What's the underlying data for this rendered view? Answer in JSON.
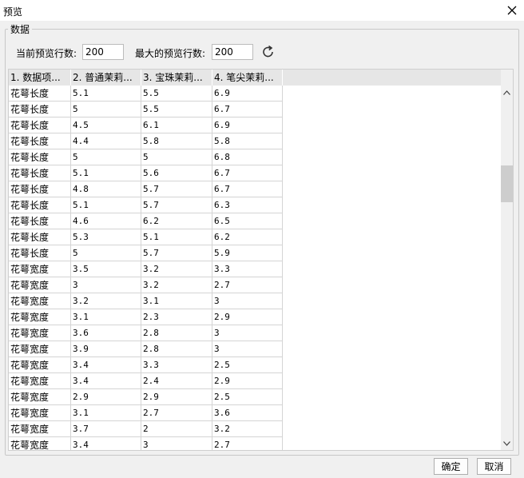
{
  "window": {
    "title": "预览"
  },
  "group": {
    "label": "数据"
  },
  "controls": {
    "current_rows_label": "当前预览行数:",
    "current_rows_value": "200",
    "max_rows_label": "最大的预览行数:",
    "max_rows_value": "200"
  },
  "table": {
    "columns": [
      "1. 数据项...",
      "2. 普通茉莉...",
      "3. 宝珠茉莉...",
      "4. 笔尖茉莉..."
    ],
    "rows": [
      [
        "花萼长度",
        "5.1",
        "5.5",
        "6.9"
      ],
      [
        "花萼长度",
        "5",
        "5.5",
        "6.7"
      ],
      [
        "花萼长度",
        "4.5",
        "6.1",
        "6.9"
      ],
      [
        "花萼长度",
        "4.4",
        "5.8",
        "5.8"
      ],
      [
        "花萼长度",
        "5",
        "5",
        "6.8"
      ],
      [
        "花萼长度",
        "5.1",
        "5.6",
        "6.7"
      ],
      [
        "花萼长度",
        "4.8",
        "5.7",
        "6.7"
      ],
      [
        "花萼长度",
        "5.1",
        "5.7",
        "6.3"
      ],
      [
        "花萼长度",
        "4.6",
        "6.2",
        "6.5"
      ],
      [
        "花萼长度",
        "5.3",
        "5.1",
        "6.2"
      ],
      [
        "花萼长度",
        "5",
        "5.7",
        "5.9"
      ],
      [
        "花萼宽度",
        "3.5",
        "3.2",
        "3.3"
      ],
      [
        "花萼宽度",
        "3",
        "3.2",
        "2.7"
      ],
      [
        "花萼宽度",
        "3.2",
        "3.1",
        "3"
      ],
      [
        "花萼宽度",
        "3.1",
        "2.3",
        "2.9"
      ],
      [
        "花萼宽度",
        "3.6",
        "2.8",
        "3"
      ],
      [
        "花萼宽度",
        "3.9",
        "2.8",
        "3"
      ],
      [
        "花萼宽度",
        "3.4",
        "3.3",
        "2.5"
      ],
      [
        "花萼宽度",
        "3.4",
        "2.4",
        "2.9"
      ],
      [
        "花萼宽度",
        "2.9",
        "2.9",
        "2.5"
      ],
      [
        "花萼宽度",
        "3.1",
        "2.7",
        "3.6"
      ],
      [
        "花萼宽度",
        "3.7",
        "2",
        "3.2"
      ],
      [
        "花萼宽度",
        "3.4",
        "3",
        "2.7"
      ]
    ]
  },
  "buttons": {
    "ok": "确定",
    "cancel": "取消"
  },
  "icons": {
    "close": "close-icon",
    "refresh": "refresh-icon",
    "scroll_up": "chevron-up-icon",
    "scroll_down": "chevron-down-icon"
  }
}
